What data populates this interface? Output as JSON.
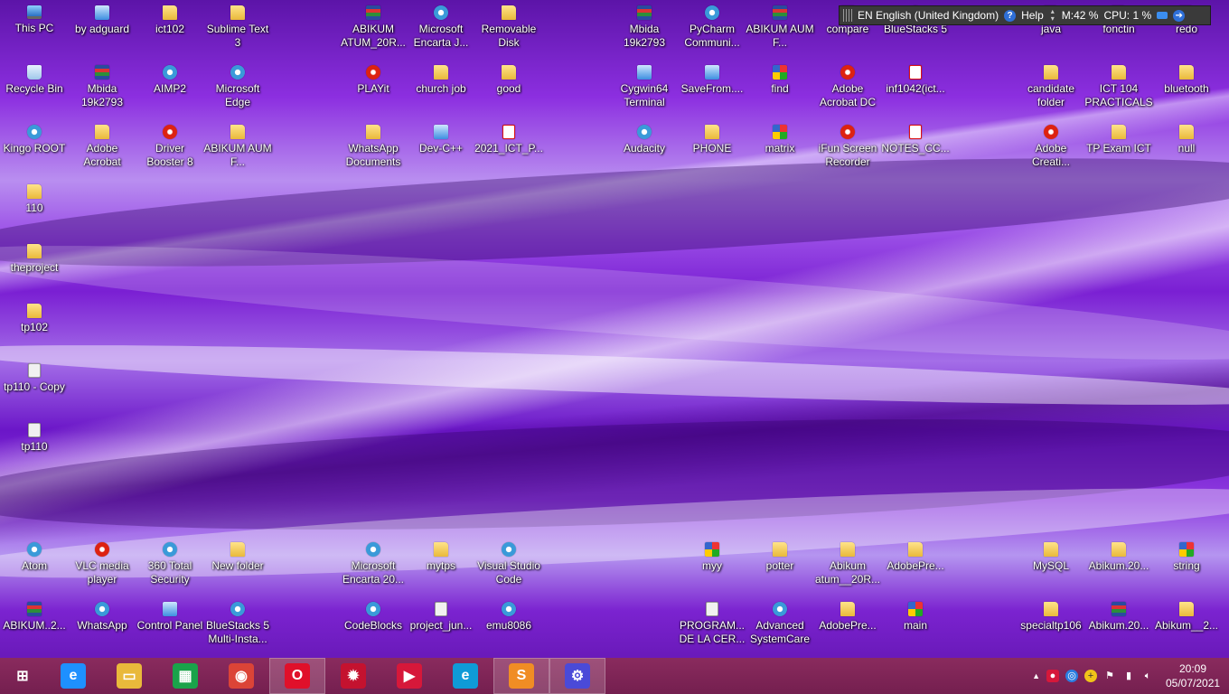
{
  "desktop": {
    "icons": [
      {
        "label": "This PC",
        "icon": "computer-icon"
      },
      {
        "label": "by adguard",
        "icon": "shortcut-icon"
      },
      {
        "label": "ict102",
        "icon": "folder-icon"
      },
      {
        "label": "Sublime Text 3",
        "icon": "folder-icon"
      },
      {
        "label": "ABIKUM ATUM_20R...",
        "icon": "rar-icon"
      },
      {
        "label": "Microsoft Encarta J...",
        "icon": "encarta-icon"
      },
      {
        "label": "Removable Disk",
        "icon": "folder-icon"
      },
      {
        "label": "Mbida 19k2793",
        "icon": "rar-icon"
      },
      {
        "label": "PyCharm Communi...",
        "icon": "pycharm-icon"
      },
      {
        "label": "ABIKUM AUM F...",
        "icon": "rar-icon"
      },
      {
        "label": "compare",
        "icon": "colorful-icon"
      },
      {
        "label": "BlueStacks 5",
        "icon": "bluestacks-icon"
      },
      {
        "label": "java",
        "icon": "folder-icon"
      },
      {
        "label": "fonctin",
        "icon": "folder-icon"
      },
      {
        "label": "redo",
        "icon": "folder-icon"
      },
      {
        "label": "Recycle Bin",
        "icon": "recycle-bin-icon"
      },
      {
        "label": "Mbida 19k2793",
        "icon": "rar-icon"
      },
      {
        "label": "AIMP2",
        "icon": "aimp-icon"
      },
      {
        "label": "Microsoft Edge",
        "icon": "edge-icon"
      },
      {
        "label": "PLAYit",
        "icon": "playit-icon"
      },
      {
        "label": "church job",
        "icon": "folder-icon"
      },
      {
        "label": "good",
        "icon": "folder-icon"
      },
      {
        "label": "Cygwin64 Terminal",
        "icon": "cygwin-icon"
      },
      {
        "label": "SaveFrom....",
        "icon": "shortcut-icon"
      },
      {
        "label": "find",
        "icon": "colorful-icon"
      },
      {
        "label": "Adobe Acrobat DC",
        "icon": "acrobat-icon"
      },
      {
        "label": "inf1042(ict...",
        "icon": "pdf-icon"
      },
      {
        "label": "candidate folder",
        "icon": "folder-icon"
      },
      {
        "label": "ICT 104 PRACTICALS",
        "icon": "folder-icon"
      },
      {
        "label": "bluetooth",
        "icon": "folder-icon"
      },
      {
        "label": "Kingo ROOT",
        "icon": "kingo-icon"
      },
      {
        "label": "Adobe Acrobat",
        "icon": "folder-icon"
      },
      {
        "label": "Driver Booster 8",
        "icon": "driver-booster-icon"
      },
      {
        "label": "ABIKUM AUM F...",
        "icon": "folder-icon"
      },
      {
        "label": "WhatsApp Documents",
        "icon": "folder-icon"
      },
      {
        "label": "Dev-C++",
        "icon": "devcpp-icon"
      },
      {
        "label": "2021_ICT_P...",
        "icon": "pdf-icon"
      },
      {
        "label": "Audacity",
        "icon": "audacity-icon"
      },
      {
        "label": "PHONE",
        "icon": "folder-icon"
      },
      {
        "label": "matrix",
        "icon": "colorful-icon"
      },
      {
        "label": "iFun Screen Recorder",
        "icon": "ifun-icon"
      },
      {
        "label": "NOTES_CC...",
        "icon": "pdf-icon"
      },
      {
        "label": "Adobe Creati...",
        "icon": "adobe-creative-icon"
      },
      {
        "label": "TP Exam ICT",
        "icon": "folder-icon"
      },
      {
        "label": "null",
        "icon": "folder-icon"
      },
      {
        "label": "110",
        "icon": "folder-icon"
      },
      {
        "label": "theproject",
        "icon": "folder-icon"
      },
      {
        "label": "tp102",
        "icon": "folder-icon"
      },
      {
        "label": "tp110 - Copy",
        "icon": "document-icon"
      },
      {
        "label": "tp110",
        "icon": "document-icon"
      },
      {
        "label": "Atom",
        "icon": "atom-icon"
      },
      {
        "label": "VLC media player",
        "icon": "vlc-icon"
      },
      {
        "label": "360 Total Security",
        "icon": "security-icon"
      },
      {
        "label": "New folder",
        "icon": "folder-icon"
      },
      {
        "label": "Microsoft Encarta 20...",
        "icon": "encarta-icon"
      },
      {
        "label": "mytps",
        "icon": "folder-icon"
      },
      {
        "label": "Visual Studio Code",
        "icon": "vscode-icon"
      },
      {
        "label": "myy",
        "icon": "colorful-icon"
      },
      {
        "label": "potter",
        "icon": "folder-icon"
      },
      {
        "label": "Abikum atum__20R...",
        "icon": "folder-icon"
      },
      {
        "label": "AdobePre...",
        "icon": "folder-icon"
      },
      {
        "label": "MySQL",
        "icon": "folder-icon"
      },
      {
        "label": "Abikum.20...",
        "icon": "folder-icon"
      },
      {
        "label": "string",
        "icon": "colorful-icon"
      },
      {
        "label": "ABIKUM..2...",
        "icon": "rar-icon"
      },
      {
        "label": "WhatsApp",
        "icon": "whatsapp-icon"
      },
      {
        "label": "Control Panel",
        "icon": "control-panel-icon"
      },
      {
        "label": "BlueStacks 5 Multi-Insta...",
        "icon": "bluestacks-icon"
      },
      {
        "label": "CodeBlocks",
        "icon": "codeblocks-icon"
      },
      {
        "label": "project_jun...",
        "icon": "document-icon"
      },
      {
        "label": "emu8086",
        "icon": "emu-icon"
      },
      {
        "label": "PROGRAM... DE LA CER...",
        "icon": "document-icon"
      },
      {
        "label": "Advanced SystemCare",
        "icon": "systemcare-icon"
      },
      {
        "label": "AdobePre...",
        "icon": "folder-icon"
      },
      {
        "label": "main",
        "icon": "colorful-icon"
      },
      {
        "label": "specialtp106",
        "icon": "folder-icon"
      },
      {
        "label": "Abikum.20...",
        "icon": "rar-icon"
      },
      {
        "label": "Abikum__2...",
        "icon": "folder-icon"
      }
    ]
  },
  "language_bar": {
    "language": "EN English (United Kingdom)",
    "help": "Help",
    "memory": "M:42 %",
    "cpu": "CPU: 1 %"
  },
  "taskbar": {
    "apps": [
      {
        "name": "start-button",
        "glyph": "⊞",
        "color": "#ffffff"
      },
      {
        "name": "internet-explorer-icon",
        "glyph": "e",
        "color": "#1e90ff"
      },
      {
        "name": "file-explorer-icon",
        "glyph": "▭",
        "color": "#e9b93b"
      },
      {
        "name": "store-icon",
        "glyph": "▦",
        "color": "#1aa34a"
      },
      {
        "name": "chrome-icon",
        "glyph": "◉",
        "color": "#db4437"
      },
      {
        "name": "opera-icon",
        "glyph": "O",
        "color": "#e0102a"
      },
      {
        "name": "app-red-gear-icon",
        "glyph": "✹",
        "color": "#c4122f"
      },
      {
        "name": "screen-recorder-icon",
        "glyph": "▶",
        "color": "#d6183a"
      },
      {
        "name": "edge-icon",
        "glyph": "e",
        "color": "#0f9bd7"
      },
      {
        "name": "sublime-text-icon",
        "glyph": "S",
        "color": "#f08d24"
      },
      {
        "name": "settings-icon",
        "glyph": "⚙",
        "color": "#4a4ad8"
      }
    ]
  },
  "tray": {
    "clock_time": "20:09",
    "clock_date": "05/07/2021"
  }
}
